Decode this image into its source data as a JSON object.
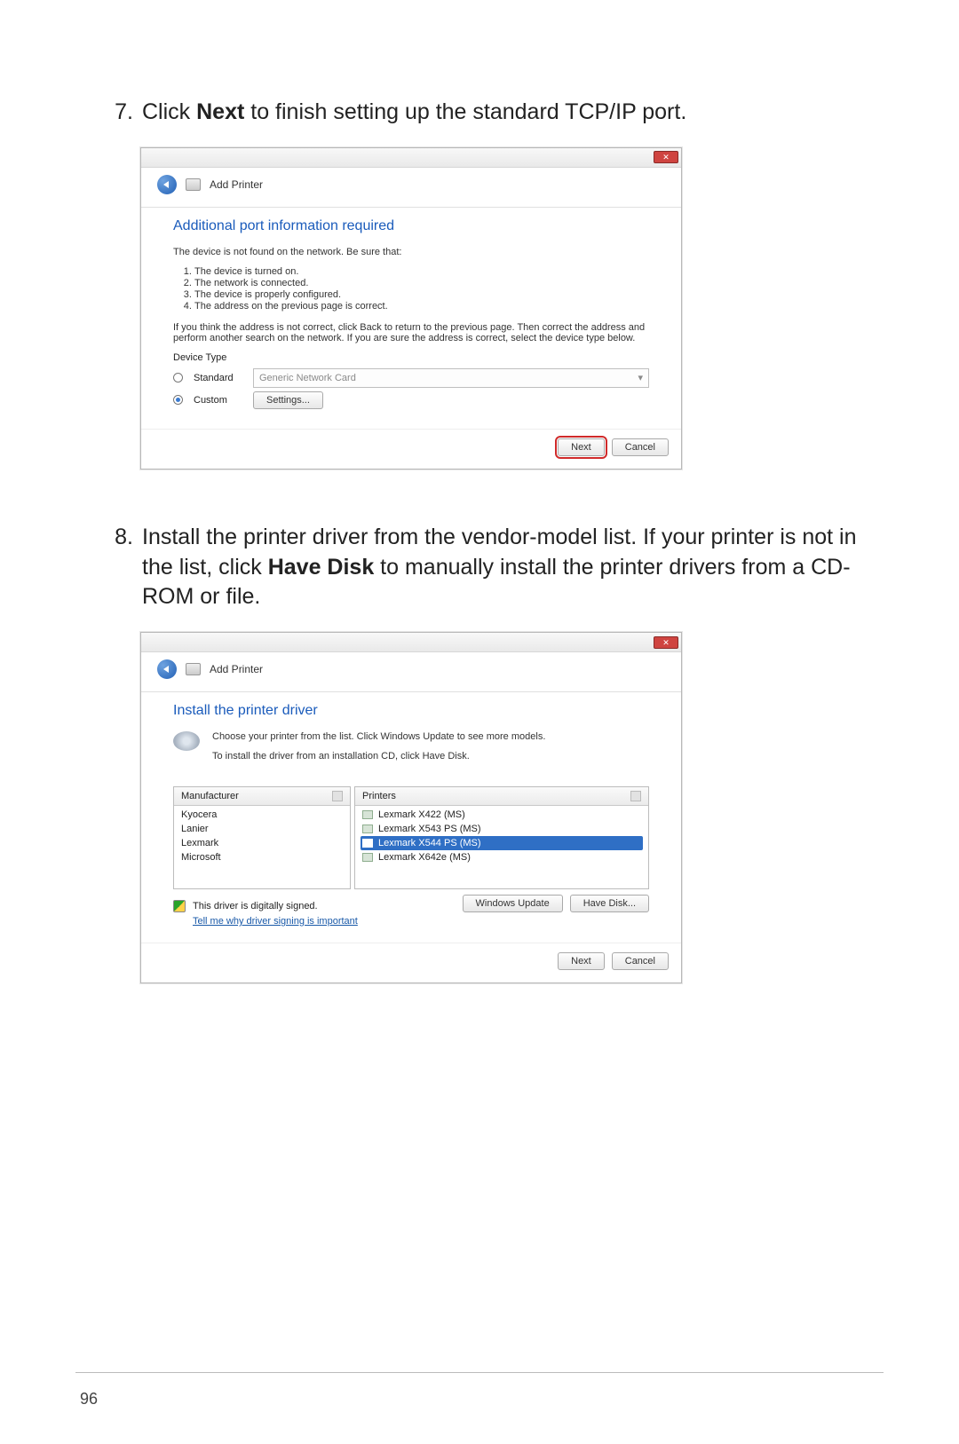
{
  "step7": {
    "num": "7.",
    "text_before": "Click ",
    "bold": "Next",
    "text_after": " to finish setting up the standard TCP/IP port."
  },
  "step8": {
    "num": "8.",
    "text_a": "Install the printer driver from the vendor-model list. If your printer is not in the list, click ",
    "bold": "Have Disk",
    "text_b": " to manually install the printer drivers from a CD-ROM or file."
  },
  "dlg1": {
    "window_title": "Add Printer",
    "heading": "Additional port information required",
    "intro": "The device is not found on the network.  Be sure that:",
    "bullets": [
      "The device is turned on.",
      "The network is connected.",
      "The device is properly configured.",
      "The address on the previous page is correct."
    ],
    "para": "If you think the address is not correct, click Back to return to the previous page.  Then correct the address and perform another search on the network.  If you are sure the address is correct, select the device type below.",
    "device_type_label": "Device Type",
    "standard": "Standard",
    "custom": "Custom",
    "combo_value": "Generic Network Card",
    "settings_btn": "Settings...",
    "next": "Next",
    "cancel": "Cancel"
  },
  "dlg2": {
    "window_title": "Add Printer",
    "heading": "Install the printer driver",
    "line1": "Choose your printer from the list. Click Windows Update to see more models.",
    "line2": "To install the driver from an installation CD, click Have Disk.",
    "manufacturer_hdr": "Manufacturer",
    "printers_hdr": "Printers",
    "manufacturers": [
      "Kyocera",
      "Lanier",
      "Lexmark",
      "Microsoft"
    ],
    "printers": [
      "Lexmark X422 (MS)",
      "Lexmark X543 PS (MS)",
      "Lexmark X544 PS (MS)",
      "Lexmark X642e (MS)"
    ],
    "signed_text": "This driver is digitally signed.",
    "signing_link": "Tell me why driver signing is important",
    "win_update": "Windows Update",
    "have_disk": "Have Disk...",
    "next": "Next",
    "cancel": "Cancel"
  },
  "page_number": "96"
}
